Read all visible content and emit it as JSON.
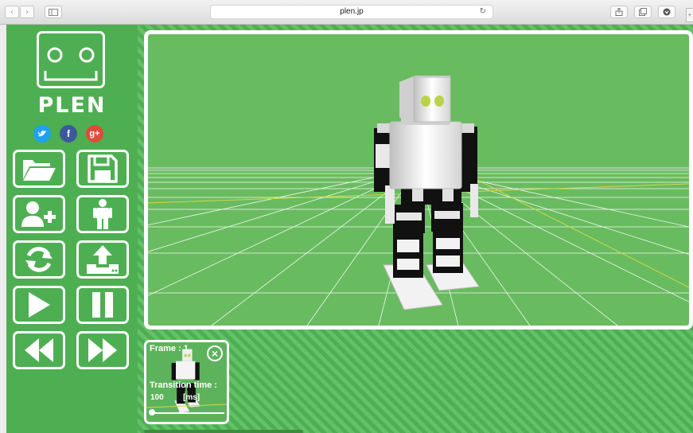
{
  "browser": {
    "url": "plen.jp",
    "back_icon": "chevron-left-icon",
    "forward_icon": "chevron-right-icon",
    "sidebar_icon": "sidebar-icon",
    "reload_icon": "reload-icon",
    "share_icon": "share-icon",
    "tabs_icon": "tabs-icon",
    "download_icon": "download-icon",
    "new_tab_label": "+"
  },
  "sidebar": {
    "logo_text": "PLEN",
    "social": [
      {
        "name": "twitter",
        "glyph": "t",
        "color": "#1da1f2"
      },
      {
        "name": "facebook",
        "glyph": "f",
        "color": "#3b5998"
      },
      {
        "name": "google-plus",
        "glyph": "g+",
        "color": "#dd4b39"
      }
    ],
    "tools": [
      {
        "name": "open",
        "icon": "folder-open-icon"
      },
      {
        "name": "save",
        "icon": "floppy-disk-icon"
      },
      {
        "name": "add-frame",
        "icon": "user-plus-icon"
      },
      {
        "name": "model",
        "icon": "person-icon"
      },
      {
        "name": "reset",
        "icon": "refresh-icon"
      },
      {
        "name": "upload",
        "icon": "upload-icon"
      },
      {
        "name": "play",
        "icon": "play-icon"
      },
      {
        "name": "pause",
        "icon": "pause-icon"
      },
      {
        "name": "rewind",
        "icon": "rewind-icon"
      },
      {
        "name": "fast-forward",
        "icon": "fast-forward-icon"
      }
    ]
  },
  "colors": {
    "brand_green": "#4daf52",
    "viewport_green": "#69bb60",
    "white": "#ffffff"
  },
  "frame": {
    "label": "Frame : 1",
    "transition_label": "Transition time :",
    "transition_value": "100",
    "transition_unit": "[ms]",
    "slider_position": 0.0
  }
}
